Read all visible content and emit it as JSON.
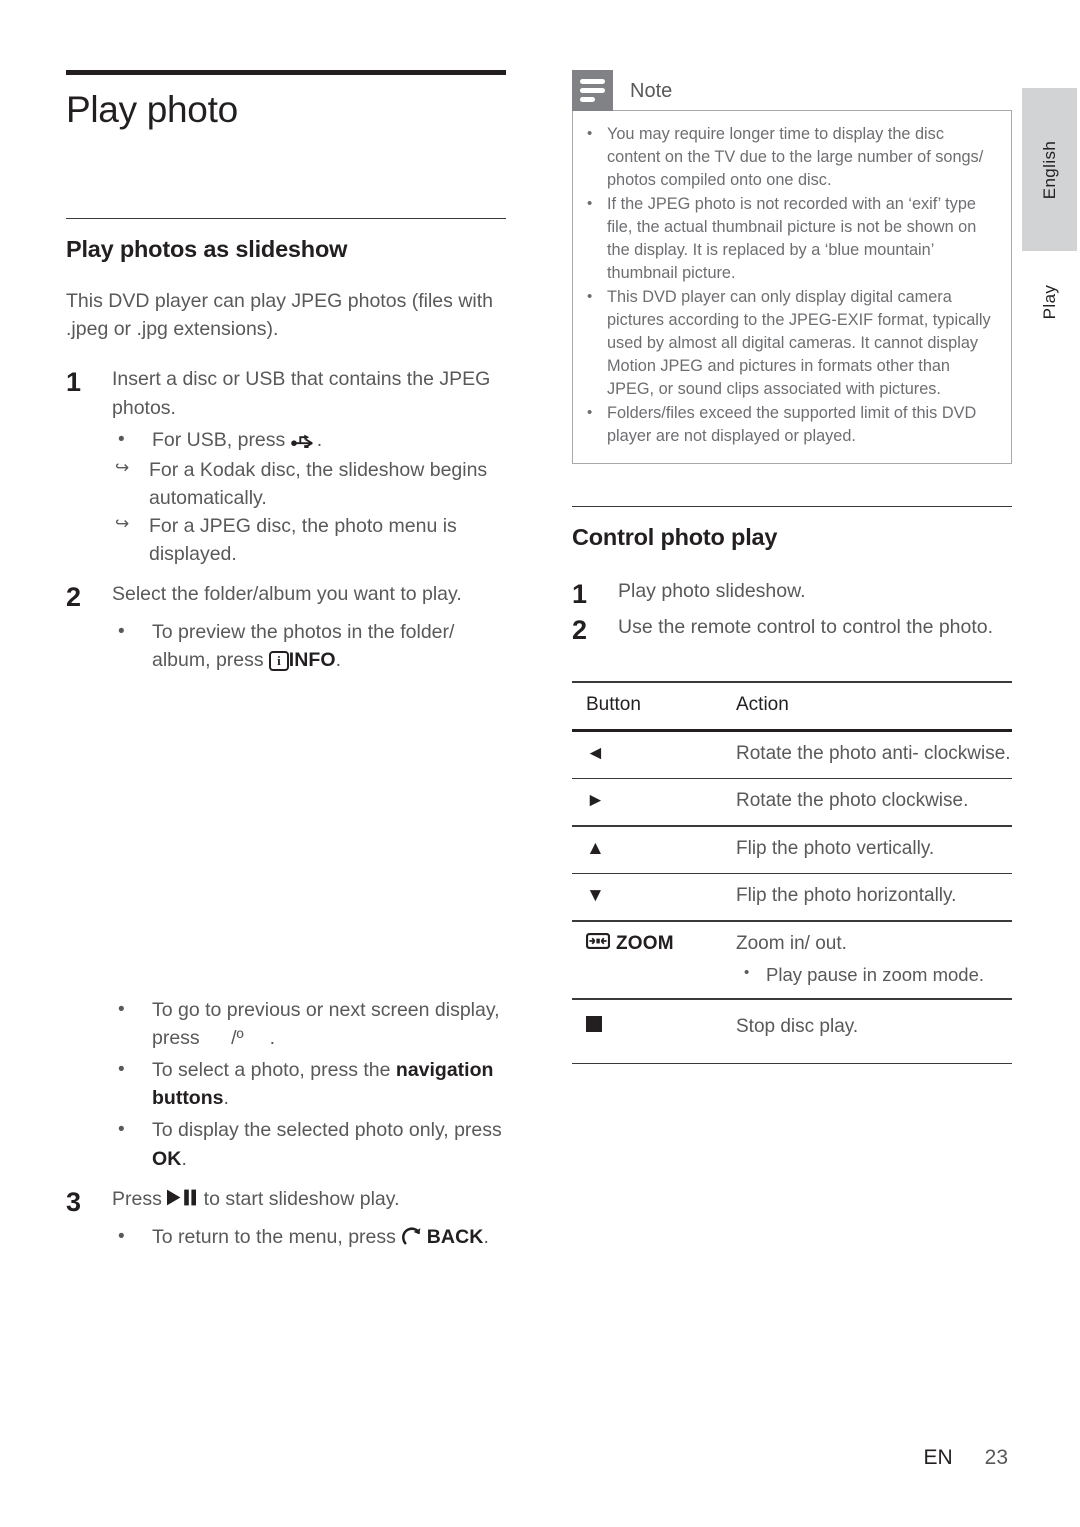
{
  "chapter": {
    "title": "Play photo"
  },
  "left_column": {
    "section_heading": "Play photos as slideshow",
    "intro": "This DVD player can play JPEG photos (files with .jpeg or .jpg extensions).",
    "steps": [
      {
        "number": "1",
        "text": "Insert a disc or USB that contains the JPEG photos.",
        "subs": [
          {
            "mark": "bullet",
            "prefix": "For USB, press ",
            "glyph": "usb-icon",
            "suffix": "."
          },
          {
            "mark": "arrow",
            "prefix": "For a Kodak disc, the slideshow begins automatically.",
            "glyph": "",
            "suffix": ""
          },
          {
            "mark": "arrow",
            "prefix": "For a JPEG disc, the photo menu is displayed.",
            "glyph": "",
            "suffix": ""
          }
        ]
      },
      {
        "number": "2",
        "text": "Select the folder/album you want to play.",
        "subs": [
          {
            "mark": "bullet",
            "prefix": "To preview the photos in the folder/ album, press ",
            "glyph": "info-icon",
            "key": "INFO",
            "suffix": "."
          }
        ]
      }
    ],
    "later_bullets": [
      {
        "prefix": "To go to previous or next screen display, press ",
        "glyph": "prev-next-missing",
        "mid": "/º",
        "suffix": "."
      },
      {
        "prefix": "To select a photo, press the ",
        "bold": "navigation buttons",
        "suffix": "."
      },
      {
        "prefix": "To display the selected photo only, press ",
        "key": "OK",
        "suffix": "."
      }
    ],
    "step3": {
      "number": "3",
      "prefix": "Press ",
      "glyph": "play-pause-icon",
      "suffix": " to start slideshow play.",
      "subs": [
        {
          "mark": "bullet",
          "prefix": "To return to the menu, press ",
          "glyph": "back-arrow-icon",
          "key": "BACK",
          "suffix": "."
        }
      ]
    }
  },
  "note": {
    "label": "Note",
    "icon": "note-lines-icon",
    "items": [
      "You may require longer time to display the disc content on the TV due to the large number of songs/ photos compiled onto one disc.",
      "If the JPEG photo is not recorded with an ‘exif’ type file, the actual thumbnail picture is not be shown on the display. It is replaced by a ‘blue mountain’ thumbnail picture.",
      "This DVD player can only display digital camera pictures according to the JPEG-EXIF format, typically used by almost all digital cameras. It cannot display Motion JPEG and pictures in formats other than JPEG, or sound clips associated with pictures.",
      "Folders/files exceed the supported limit of this DVD player are not displayed or played."
    ]
  },
  "control": {
    "section_heading": "Control photo play",
    "steps": [
      {
        "number": "1",
        "text": "Play photo slideshow."
      },
      {
        "number": "2",
        "text": "Use the remote control to control the photo."
      }
    ],
    "table": {
      "headers": {
        "button": "Button",
        "action": "Action"
      },
      "rows": [
        {
          "button_glyph": "left-arrow-icon",
          "button_label": "◄",
          "action": "Rotate the photo anti- clockwise.",
          "sub": ""
        },
        {
          "button_glyph": "right-arrow-icon",
          "button_label": "►",
          "action": "Rotate the photo clockwise.",
          "sub": ""
        },
        {
          "button_glyph": "up-arrow-icon",
          "button_label": "▲",
          "action": "Flip the photo vertically.",
          "sub": ""
        },
        {
          "button_glyph": "down-arrow-icon",
          "button_label": "▼",
          "action": "Flip the photo horizontally.",
          "sub": ""
        },
        {
          "button_glyph": "zoom-icon",
          "button_label": "ZOOM",
          "action": "Zoom in/ out.",
          "sub": "Play pause in zoom mode."
        },
        {
          "button_glyph": "stop-icon",
          "button_label": "■",
          "action": "Stop disc play.",
          "sub": ""
        }
      ]
    }
  },
  "side_tabs": {
    "language": "English",
    "chapter": "Play"
  },
  "footer": {
    "language_code": "EN",
    "page_number": "23"
  },
  "colors": {
    "ink": "#231f20",
    "body_gray": "#58595b",
    "note_gray": "#6d6e71",
    "tab_gray": "#d2d3d5",
    "note_icon_gray": "#808285",
    "rule": "#3a3a3a"
  }
}
